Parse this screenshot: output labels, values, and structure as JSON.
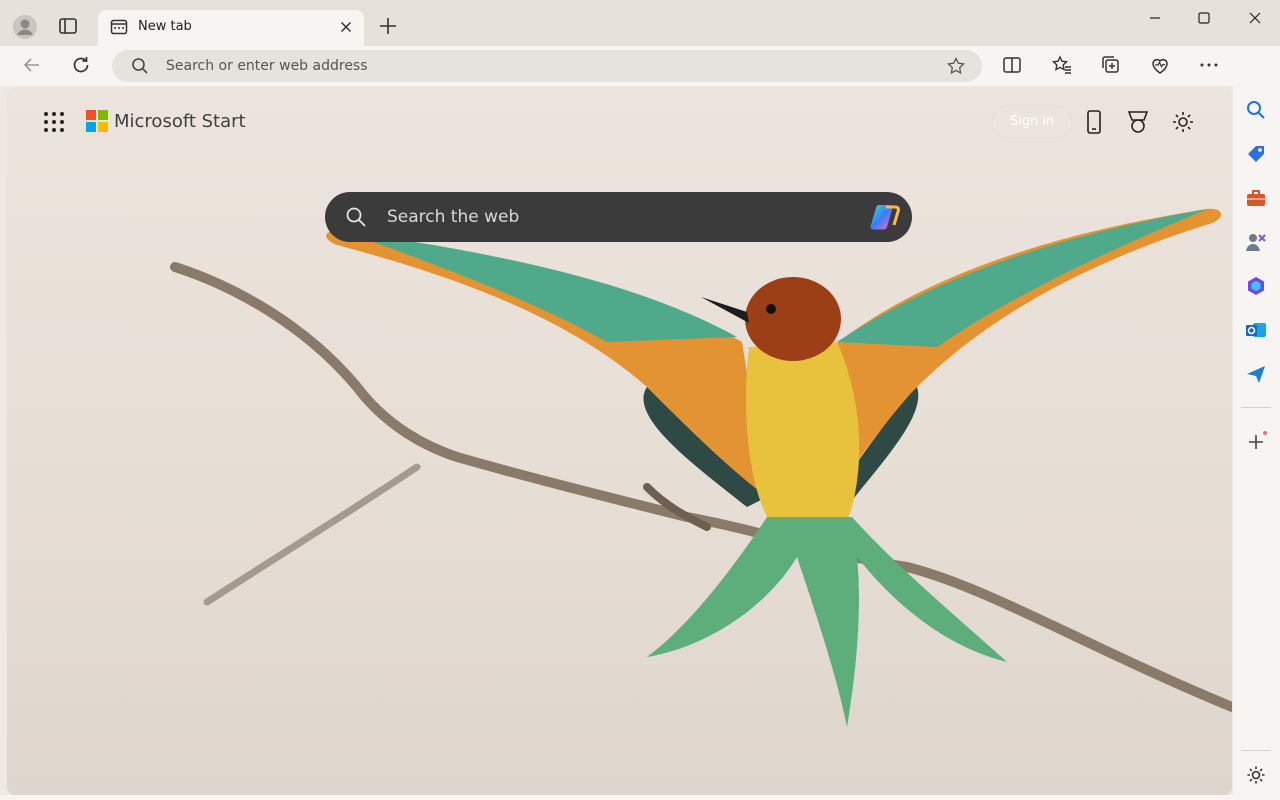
{
  "tab": {
    "title": "New tab"
  },
  "address_bar": {
    "placeholder": "Search or enter web address"
  },
  "page": {
    "brand": "Microsoft Start",
    "signin_label": "Sign in",
    "search_placeholder": "Search the web"
  },
  "icons": {
    "titlebar": [
      "profile-icon",
      "tab-actions-icon",
      "new-tab-icon",
      "minimize-icon",
      "maximize-icon",
      "close-window-icon"
    ],
    "toolbar": [
      "back-icon",
      "refresh-icon",
      "split-screen-icon",
      "favorites-icon",
      "collections-icon",
      "browser-essentials-icon",
      "more-icon",
      "copilot-icon"
    ],
    "sidebar": [
      "search-icon",
      "shopping-icon",
      "tools-icon",
      "games-icon",
      "microsoft365-icon",
      "outlook-icon",
      "drop-icon",
      "add-icon",
      "settings-icon"
    ]
  },
  "colors": {
    "search_bar": "#3b3b3b",
    "page_background": "#ece5dd",
    "chrome": "#f7f4f1"
  }
}
